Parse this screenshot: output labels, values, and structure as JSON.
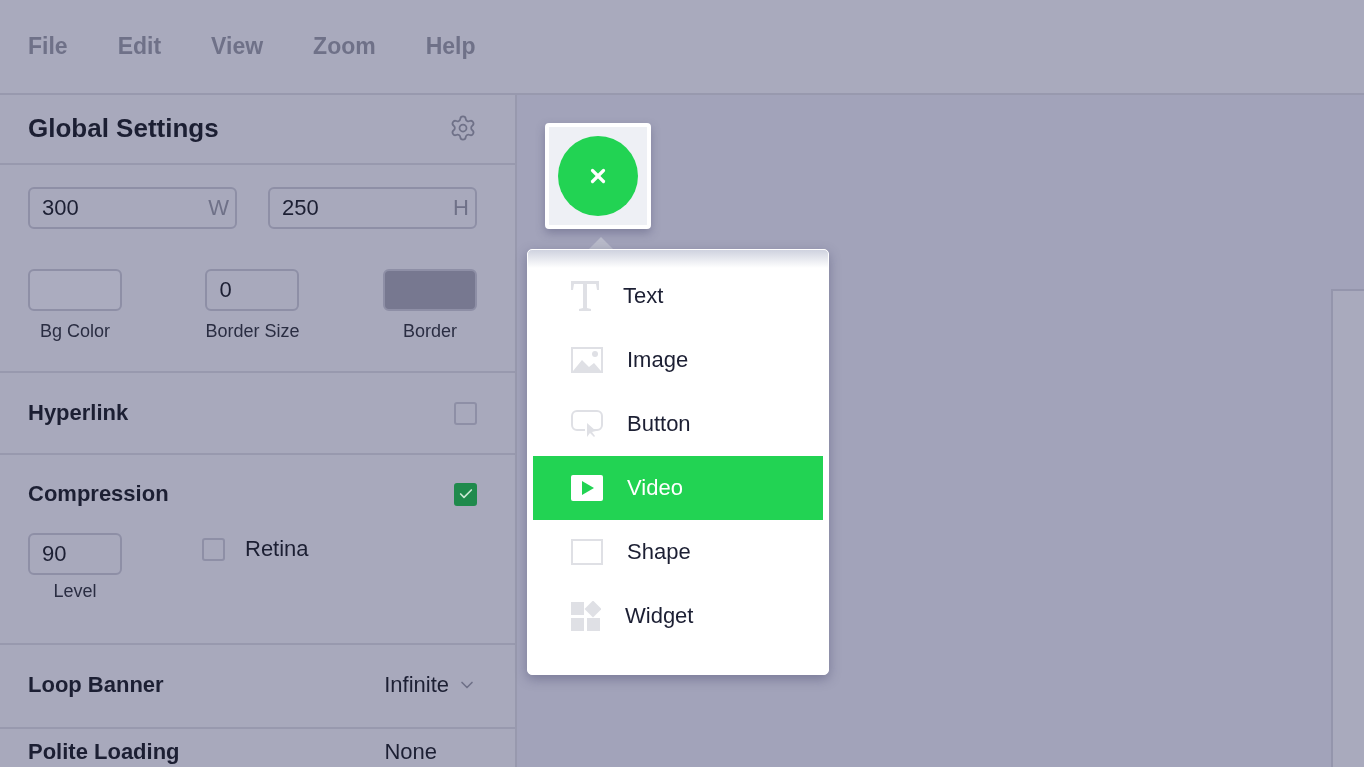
{
  "menu": [
    "File",
    "Edit",
    "View",
    "Zoom",
    "Help"
  ],
  "settings": {
    "title": "Global Settings",
    "size_fields": [
      {
        "value": "300",
        "unit": "W"
      },
      {
        "value": "250",
        "unit": "H"
      }
    ],
    "appearance": [
      {
        "kind": "swatch",
        "label": "Bg Color",
        "color": "#abacbf"
      },
      {
        "kind": "number",
        "label": "Border Size",
        "value": "0"
      },
      {
        "kind": "swatch",
        "label": "Border",
        "color": "#777890"
      }
    ],
    "hyperlink": {
      "label": "Hyperlink",
      "checked": false
    },
    "compression": {
      "label": "Compression",
      "checked": true,
      "level": {
        "value": "90",
        "label": "Level"
      },
      "retina": {
        "label": "Retina",
        "checked": false
      }
    },
    "loop_banner": {
      "label": "Loop Banner",
      "value": "Infinite"
    },
    "polite_loading": {
      "label": "Polite Loading",
      "value": "None"
    }
  },
  "canvas": {
    "add_menu": [
      {
        "kind": "text",
        "label": "Text",
        "selected": false
      },
      {
        "kind": "image",
        "label": "Image",
        "selected": false
      },
      {
        "kind": "button",
        "label": "Button",
        "selected": false
      },
      {
        "kind": "video",
        "label": "Video",
        "selected": true
      },
      {
        "kind": "shape",
        "label": "Shape",
        "selected": false
      },
      {
        "kind": "widget",
        "label": "Widget",
        "selected": false
      }
    ]
  }
}
